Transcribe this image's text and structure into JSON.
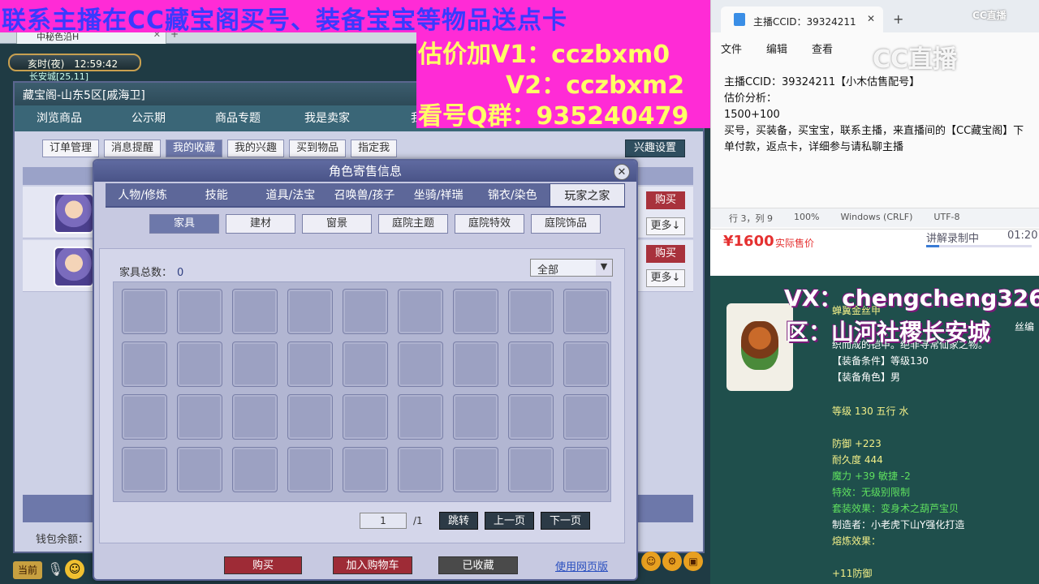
{
  "banner": {
    "top_line": "联系主播在CC藏宝阁买号、装备宝宝等物品送点卡",
    "promo_v1": "估价加V1：cczbxm0",
    "promo_v2": "V2：cczbxm2",
    "promo_qq": "看号Q群：935240479"
  },
  "game": {
    "browser_tab_label": "中秘色沿H",
    "clock_period": "亥时(夜)",
    "clock_time": "12:59:42",
    "location": "长安城[25,11]",
    "window_title": "藏宝阁-山东5区[戚海卫]",
    "main_tabs": [
      "浏览商品",
      "公示期",
      "商品专题",
      "我是卖家",
      "我"
    ],
    "sub_tabs": [
      "订单管理",
      "消息提醒",
      "我的收藏",
      "我的兴趣",
      "买到物品",
      "指定我"
    ],
    "sub_tab_active": "我的收藏",
    "interest_settings": "兴趣设置",
    "row_buy_label": "购买",
    "row_more_label": "更多↓",
    "wallet_label": "钱包余额：",
    "hud_current": "当前"
  },
  "dialog": {
    "title": "角色寄售信息",
    "close": "✕",
    "tabs": [
      "人物/修炼",
      "技能",
      "道具/法宝",
      "召唤兽/孩子",
      "坐骑/祥瑞",
      "锦衣/染色",
      "玩家之家"
    ],
    "active_tab": "玩家之家",
    "home_tabs": [
      "家具",
      "建材",
      "窗景",
      "庭院主题",
      "庭院特效",
      "庭院饰品"
    ],
    "active_home_tab": "家具",
    "furniture_count_label": "家具总数：",
    "furniture_count": "0",
    "filter_value": "全部",
    "page_current": "1",
    "page_total": "/1",
    "btn_jump": "跳转",
    "btn_prev": "上一页",
    "btn_next": "下一页",
    "btn_buy": "购买",
    "btn_cart": "加入购物车",
    "btn_favorited": "已收藏",
    "link_web": "使用网页版"
  },
  "notepad": {
    "tab_title": "主播CCID：39324211",
    "menu": [
      "文件",
      "编辑",
      "查看"
    ],
    "lines": [
      "主播CCID：39324211【小木估售配号】",
      "估价分析：",
      "1500+100",
      "买号，买装备，买宝宝，联系主播，来直播间的【CC藏宝阁】下单付款，返点卡，详细参与请私聊主播"
    ],
    "status": [
      "行 3，列 9",
      "100%",
      "Windows (CRLF)",
      "UTF-8"
    ]
  },
  "cc_logo": "CC直播",
  "cc_logo_small": "CC直播",
  "price": {
    "value": "¥1600",
    "label": "实际售价",
    "recording_label": "讲解录制中",
    "recording_time": "01:20",
    "recording_progress": 0.12
  },
  "item": {
    "name_partial": "蝉翼金丝甲",
    "desc_tail": "丝编",
    "desc": "织而成的铠甲。绝非寻常仙家之物。",
    "condition": "【装备条件】等级130",
    "role": "【装备角色】男",
    "level_line": "等级 130  五行 水",
    "defense": "防御 +223",
    "durability": "耐久度 444",
    "magic": "魔力 +39 敏捷 -2",
    "effect": "特效：无级别限制",
    "set": "套装效果：变身术之葫芦宝贝",
    "maker": "制造者：小老虎下山Y强化打造",
    "refine_label": "熔炼效果：",
    "refine_value": "+11防御"
  },
  "overlay": {
    "vx": "VX：chengcheng326",
    "zone": "区：山河社稷长安城"
  },
  "colors": {
    "banner_bg": "#ff2bd6",
    "banner_text": "#3a3aff",
    "promo_text": "#ffff66",
    "price_red": "#e53030",
    "item_panel_bg": "#1f4f4c"
  }
}
